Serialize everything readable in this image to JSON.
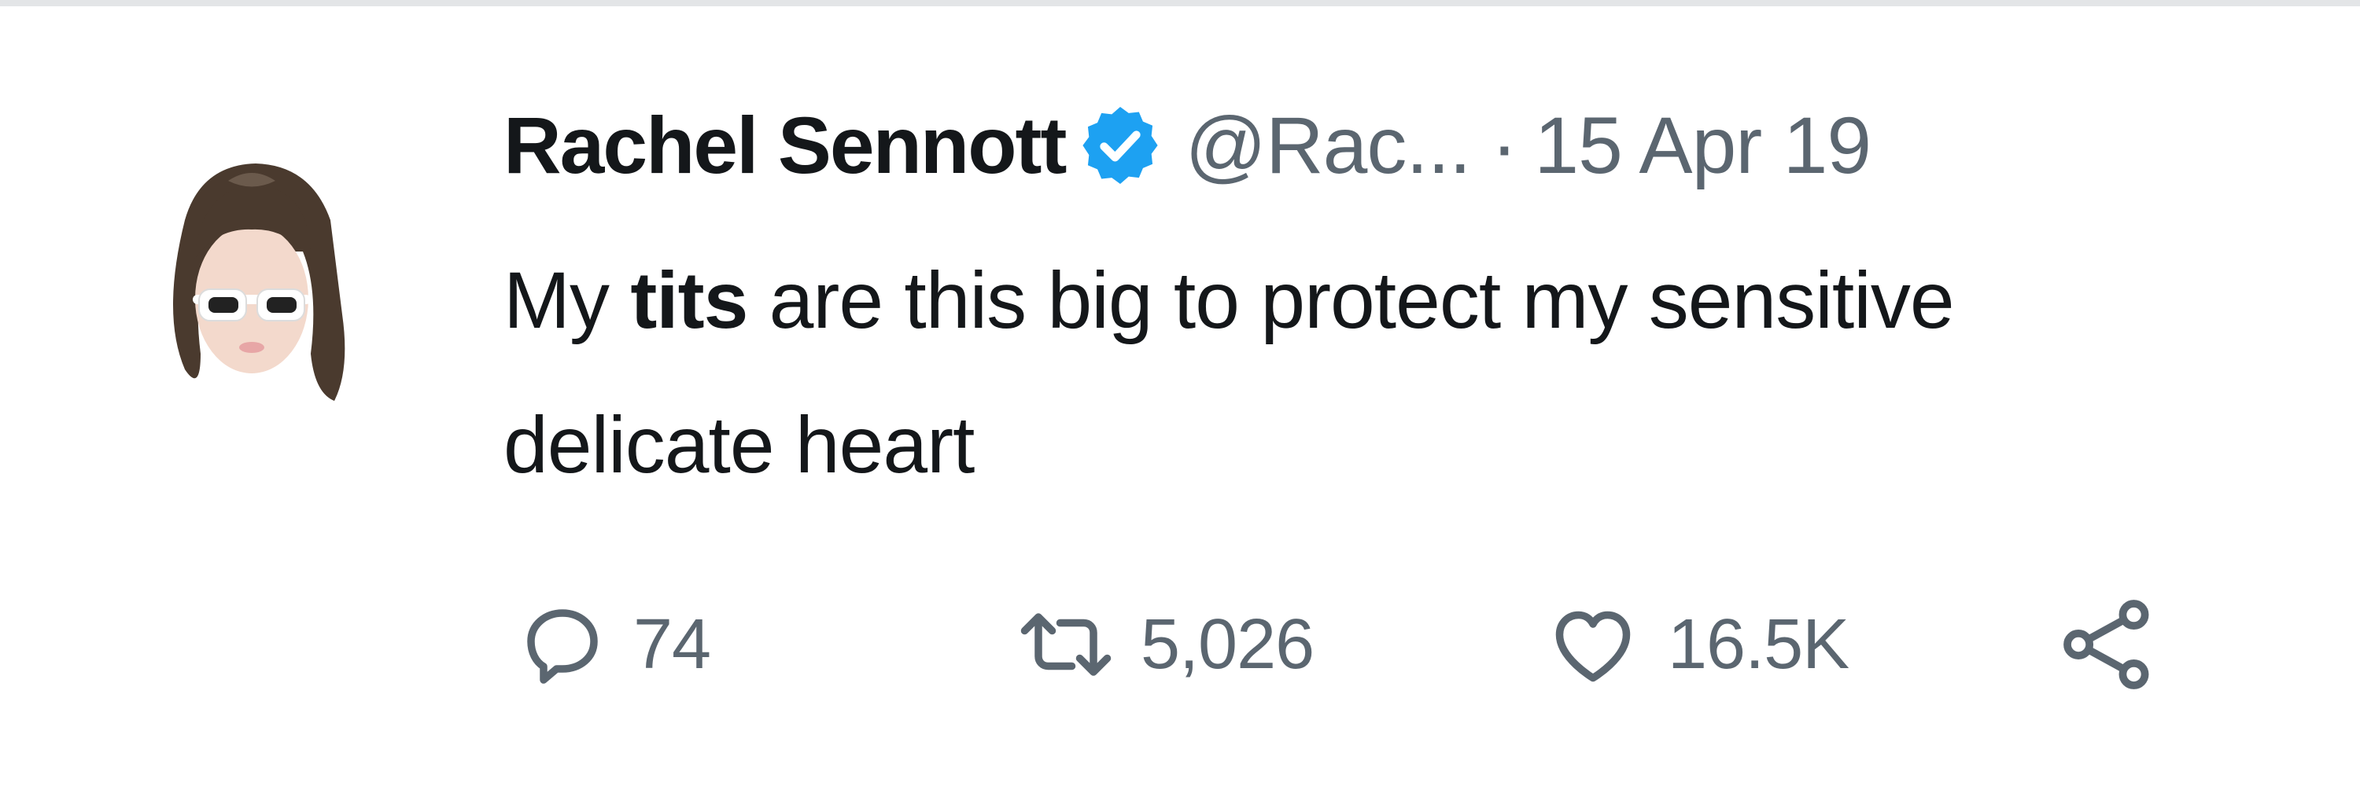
{
  "tweet": {
    "author": {
      "display_name": "Rachel Sennott",
      "verified": true,
      "handle": "@Rac...",
      "avatar_icon": "profile-avatar"
    },
    "separator": "·",
    "timestamp": "15 Apr 19",
    "text": {
      "prefix": "My ",
      "bold": "tits",
      "suffix": " are this big to protect my sensitive delicate heart"
    },
    "actions": {
      "reply": {
        "icon": "reply-icon",
        "count": "74"
      },
      "retweet": {
        "icon": "retweet-icon",
        "count": "5,026"
      },
      "like": {
        "icon": "heart-icon",
        "count": "16.5K"
      },
      "share": {
        "icon": "share-icon"
      }
    }
  },
  "colors": {
    "text_primary": "#14171a",
    "text_secondary": "#5b6670",
    "verified_blue": "#1da1f2",
    "background": "#ffffff"
  }
}
